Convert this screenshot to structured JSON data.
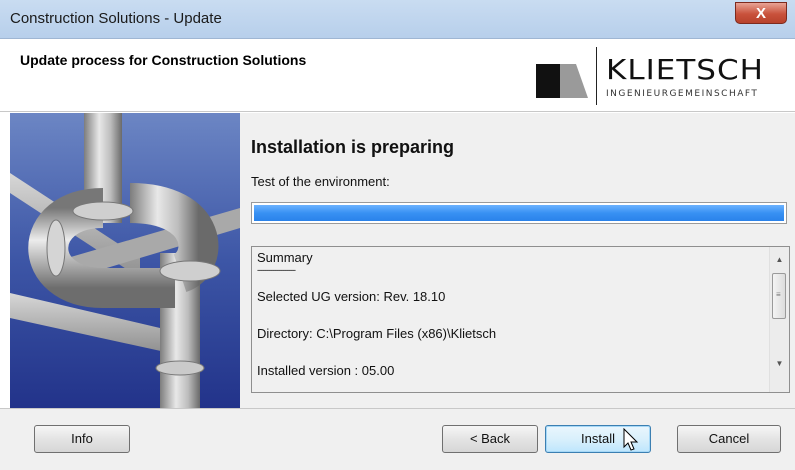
{
  "window": {
    "title": "Construction Solutions - Update",
    "close_label": "X"
  },
  "header": {
    "title": "Update process for Construction Solutions",
    "logo": {
      "name": "KLIETSCH",
      "subtitle": "INGENIEURGEMEINSCHAFT"
    }
  },
  "main": {
    "heading": "Installation is preparing",
    "subtitle": "Test of the environment:",
    "progress": 1.0,
    "summary": {
      "lines": [
        "Summary",
        "-------------------",
        "Selected UG version: Rev. 18.10",
        "Directory: C:\\Program Files (x86)\\Klietsch",
        "Installed version : 05.00"
      ]
    }
  },
  "footer": {
    "info_label": "Info",
    "back_label": "< Back",
    "install_label": "Install",
    "cancel_label": "Cancel"
  },
  "colors": {
    "progress": "#3891f3",
    "titlebar": "#b7cfeb",
    "close": "#c9523c"
  },
  "icons": [
    "close-icon",
    "logo-icon",
    "scroll-up-icon",
    "scroll-down-icon",
    "mouse-cursor-icon"
  ]
}
